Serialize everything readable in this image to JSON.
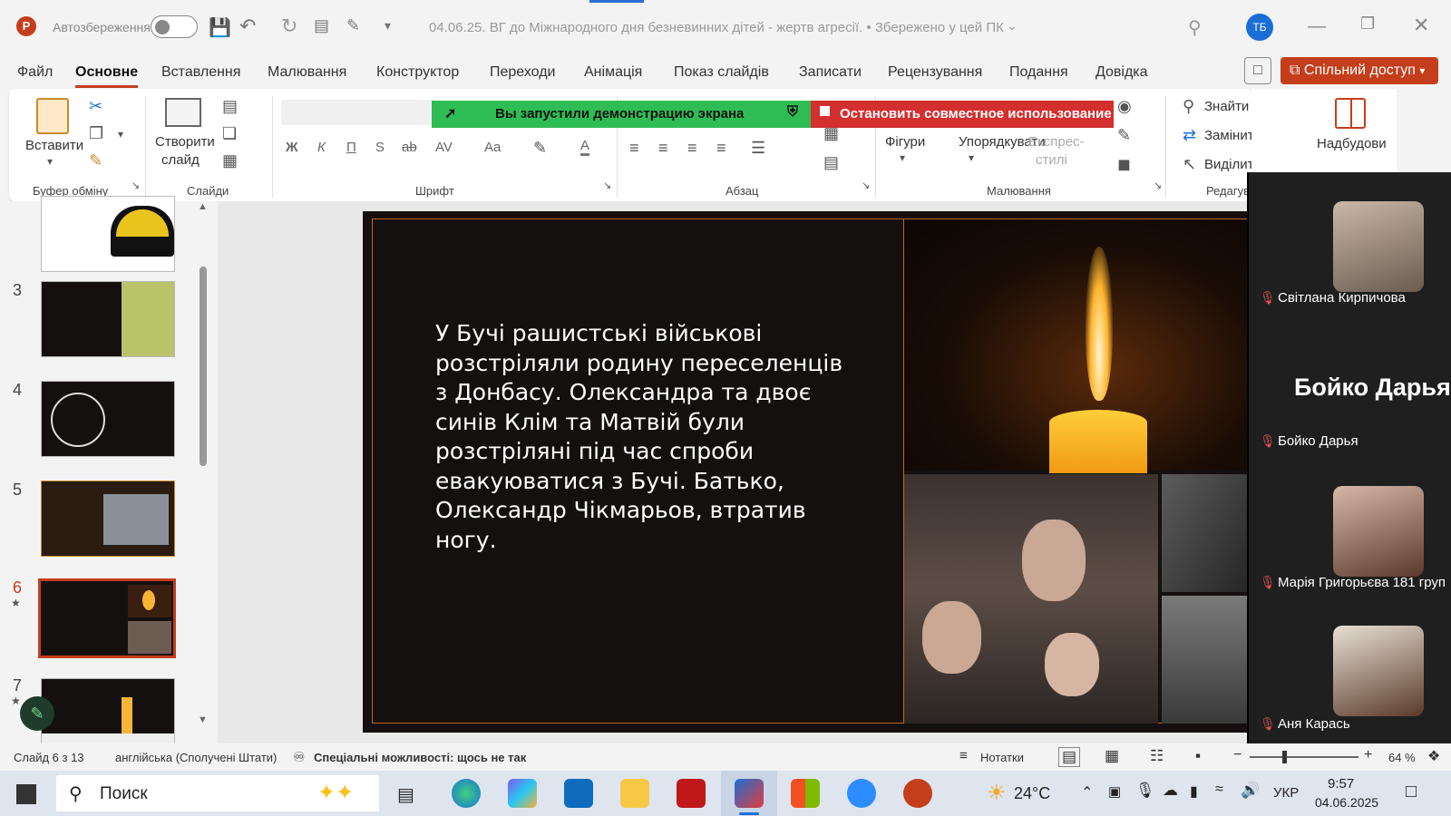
{
  "titlebar": {
    "autosave_label": "Автозбереження",
    "doc_title": "04.06.25. ВГ до Міжнародного дня безневинних дітей - жертв агресії. • Збережено у цей ПК",
    "user_initials": "ТБ"
  },
  "menu": {
    "tabs": [
      "Файл",
      "Основне",
      "Вставлення",
      "Малювання",
      "Конструктор",
      "Переходи",
      "Анімація",
      "Показ слайдів",
      "Записати",
      "Рецензування",
      "Подання",
      "Довідка"
    ],
    "active_tab": "Основне",
    "share_label": "Спільний доступ"
  },
  "ribbon": {
    "paste": "Вставити",
    "new_slide_line1": "Створити",
    "new_slide_line2": "слайд",
    "group_clipboard": "Буфер обміну",
    "group_slides": "Слайди",
    "group_font": "Шрифт",
    "group_paragraph": "Абзац",
    "group_drawing": "Малювання",
    "group_editing": "Редагув",
    "shapes": "Фігури",
    "arrange": "Упорядкувати",
    "quick_styles_line1": "Експрес-",
    "quick_styles_line2": "стилі",
    "find": "Знайти",
    "replace": "Замінити",
    "select": "Виділити",
    "addins": "Надбудови",
    "bold": "Ж",
    "italic": "К",
    "underline": "П",
    "strike": "S",
    "spacing": "AV",
    "case": "Aa",
    "fontcolor": "A"
  },
  "share_banner": {
    "status": "Вы запустили демонстрацию экрана",
    "stop": "Остановить совместное использование"
  },
  "thumbnails": [
    {
      "num": "3",
      "star": ""
    },
    {
      "num": "4",
      "star": ""
    },
    {
      "num": "5",
      "star": ""
    },
    {
      "num": "6",
      "star": "★"
    },
    {
      "num": "7",
      "star": "★"
    }
  ],
  "slide": {
    "text": "У Бучі рашистські військові розстріляли родину  переселенців з Донбасу. Олександра та двоє синів Клім та Матвій  були розстріляні під час спроби евакуюватися з Бучі. Батько, Олександр Чікмарьов, втратив ногу."
  },
  "participants": {
    "items": [
      {
        "name": "Світлана Кирпичова"
      },
      {
        "name": "Бойко Дарья",
        "big_name": "Бойко Дарья"
      },
      {
        "name": "Марія Григорьєва 181 груп"
      },
      {
        "name": "Аня Карась"
      }
    ]
  },
  "status": {
    "slide_info": "Слайд 6 з 13",
    "language": "англійська (Сполучені Штати)",
    "accessibility": "Спеціальні можливості: щось не так",
    "notes": "Нотатки",
    "zoom": "64 %"
  },
  "taskbar": {
    "search": "Поиск",
    "weather": "24°C",
    "lang": "УКР",
    "time": "9:57",
    "date": "04.06.2025"
  },
  "colors": {
    "accent": "#c43e1c",
    "share_green": "#2ebd55",
    "stop_red": "#d32f2f"
  }
}
